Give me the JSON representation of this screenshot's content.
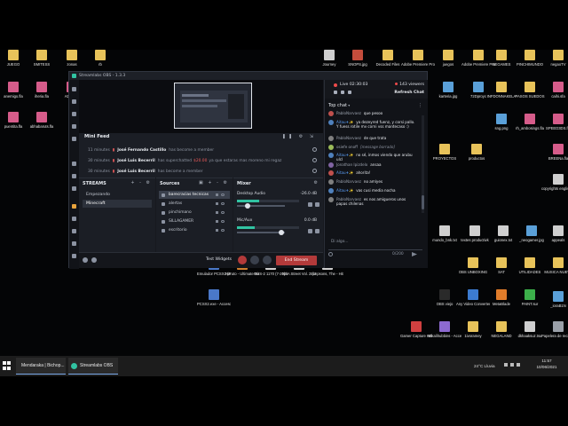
{
  "desktop_icons_top": [
    {
      "label": "JUEGO",
      "color": "#e8c35a"
    },
    {
      "label": "SMITESS",
      "color": "#e8c35a"
    },
    {
      "label": "zonas",
      "color": "#e8c35a"
    },
    {
      "label": "rb",
      "color": "#e8c35a"
    },
    {
      "label": "Journey",
      "color": "#cfcfcf"
    },
    {
      "label": "SNOPS.jpg",
      "color": "#c44d3c"
    },
    {
      "label": "Decoded Files",
      "color": "#e8c35a"
    },
    {
      "label": "Adobe Premiere Pro Preview Files",
      "color": "#e8c35a"
    },
    {
      "label": "juegos",
      "color": "#e8c35a"
    },
    {
      "label": "Adobe Premiere Pro Auto-Saves",
      "color": "#e8c35a"
    },
    {
      "label": "NEGAMES",
      "color": "#e8c35a"
    },
    {
      "label": "PINCHIMUNDO",
      "color": "#e8c35a"
    },
    {
      "label": "negaoTV",
      "color": "#e8c35a"
    }
  ],
  "desktop_icons_row2": [
    {
      "label": "anemigo.fla",
      "color": "#d65c8a"
    },
    {
      "label": "iheria.fla",
      "color": "#d65c8a"
    },
    {
      "label": "ADSo.fla",
      "color": "#d65c8a"
    },
    {
      "label": "xx.fla",
      "color": "#d65c8a"
    },
    {
      "label": "karteria.jpg",
      "color": "#5aa0d8"
    },
    {
      "label": "72Dproyc",
      "color": "#5aa0d8"
    },
    {
      "label": "INFDONNAKELA",
      "color": "#e8c35a"
    },
    {
      "label": "PASOS SUEDOS",
      "color": "#e8c35a"
    },
    {
      "label": "caihi.sfa",
      "color": "#d65c8a"
    }
  ],
  "desktop_icons_row3": [
    {
      "label": "puentita.fla",
      "color": "#d65c8a"
    },
    {
      "label": "abhabaruts.fla",
      "color": "#d65c8a"
    },
    {
      "label": "sng.png",
      "color": "#5aa0d8"
    },
    {
      "label": "rh_ambosings.fla",
      "color": "#d65c8a"
    },
    {
      "label": "SPEED3DS.fla",
      "color": "#d65c8a"
    }
  ],
  "desktop_icons_row4": [
    {
      "label": "PROYECTOS",
      "color": "#e8c35a"
    },
    {
      "label": "productos",
      "color": "#e8c35a"
    },
    {
      "label": "BREENa.fla",
      "color": "#d65c8a"
    }
  ],
  "desktop_icons_right": [
    {
      "label": "copyrights english depon",
      "color": "#cfcfcf"
    },
    {
      "label": "appeals",
      "color": "#cfcfcf"
    },
    {
      "label": "MUSICA NUEVA",
      "color": "#e8c35a"
    },
    {
      "label": "_ioraB1N",
      "color": "#5aa0d8"
    },
    {
      "label": "Papelera de reciclaje",
      "color": "#9aa0a8"
    }
  ],
  "desktop_icons_row5": [
    {
      "label": "mundo_bnk.txt",
      "color": "#cfcfcf"
    },
    {
      "label": "textes productivk",
      "color": "#cfcfcf"
    },
    {
      "label": "guionex.txt",
      "color": "#cfcfcf"
    },
    {
      "label": "_neogamer.jpg",
      "color": "#5aa0d8"
    }
  ],
  "desktop_icons_row6": [
    {
      "label": "OBS UNBOXING",
      "color": "#e8c35a"
    },
    {
      "label": "SAT",
      "color": "#e8c35a"
    },
    {
      "label": "UTILIDADES",
      "color": "#e8c35a"
    }
  ],
  "desktop_icons_row7": [
    {
      "label": "OBS viejo",
      "color": "#2a2a2a"
    },
    {
      "label": "Any Video Converter",
      "color": "#3c7bd0"
    },
    {
      "label": "MetaBlade",
      "color": "#e07c2a"
    },
    {
      "label": "PAINT.sur",
      "color": "#3cb04a"
    }
  ],
  "desktop_icons_row8": [
    {
      "label": "Gamer Capture HD",
      "color": "#d04040"
    },
    {
      "label": "Mikalihubbins - Acceso directo",
      "color": "#8d6ad0"
    },
    {
      "label": "1ivoramey",
      "color": "#e8c35a"
    },
    {
      "label": "NEGALAND",
      "color": "#e8c35a"
    },
    {
      "label": "dkhaaksuz.tsu",
      "color": "#cfcfcf"
    }
  ],
  "desktop_icons_midbottom": [
    {
      "label": "Emulador PCSX2 (Portable)",
      "color": "#4a78c8"
    },
    {
      "label": "Naruto - Ultimate Ninja...",
      "color": "#d08030"
    },
    {
      "label": "GUS-2 1170 (7-20).iso",
      "color": "#cfcfcf"
    },
    {
      "label": "NBA Street Vol. 2 (USA).iso",
      "color": "#cfcfcf"
    },
    {
      "label": "Simpsons, The - Hit & Run.iso",
      "color": "#cfcfcf"
    },
    {
      "label": "PCSX2.exe - Acceso directo",
      "color": "#4a78c8"
    }
  ],
  "obs": {
    "title": "Streamlabs OBS - 1.3.3",
    "mini_feed": {
      "heading": "Mini Feed",
      "rows": [
        {
          "time": "11 minutes",
          "name": "José Fernando Castillo",
          "text": "has become a member"
        },
        {
          "time": "30 minutes",
          "name": "José Luis Becerril",
          "text": "has superchatted",
          "amount": "$20.00",
          "text2": "ya que estaras mas moreno mi regaz"
        },
        {
          "time": "30 minutes",
          "name": "José Luis Becerril",
          "text": "has become a member"
        }
      ]
    },
    "streams": {
      "title": "STREAMS",
      "tools": "+ - ⚙",
      "items": [
        "Empezando",
        "Minecraft"
      ],
      "selected": 1
    },
    "sources": {
      "title": "Sources",
      "tools": "▣ + - ⚙",
      "items": [
        "barecracias tecnicas",
        "alertas",
        "pinchimano",
        "SILLAGAMER",
        "escritorio"
      ],
      "selected": 0
    },
    "mixer": {
      "title": "Mixer",
      "tools": "⚙",
      "channels": [
        {
          "name": "Desktop Audio",
          "db": "-26.0 dB",
          "level": 0.35,
          "volume": 0.22
        },
        {
          "name": "Mic/Aux",
          "db": "0.0 dB",
          "level": 0.28,
          "volume": 0.92
        }
      ]
    },
    "bottom": {
      "test_widgets": "Test Widgets",
      "end_stream": "End Stream"
    },
    "chat": {
      "live_time": "Live 02:30:03",
      "viewers": "143 viewers",
      "refresh": "Refresh Chat",
      "top_chat": "Top chat",
      "menu": "⋮",
      "messages": [
        {
          "author": "PabloNarvaez",
          "text": "que pesoo",
          "avatar": "#c0504d",
          "blue": false
        },
        {
          "author": "Aitau✈✨",
          "text": "ya dezeyred fuenz, y corsi pallo. Y fuess rotile mv corni vss mantecaso :)",
          "avatar": "#4f81bd",
          "blue": true
        },
        {
          "author": "PabloNarvaez",
          "text": "de que trata",
          "avatar": "#7f7f7f",
          "blue": false
        },
        {
          "author": "osiefe onoff",
          "text": "[message borrado]",
          "avatar": "#9bbb59",
          "blue": false,
          "deleted": true
        },
        {
          "author": "Aitau✈✨",
          "text": "no sé, inmos viendo que arubu ulcl",
          "avatar": "#4f81bd",
          "blue": true
        },
        {
          "author": "Jonathan Ipizdelo",
          "text": "ansaa",
          "avatar": "#8064a2",
          "blue": false
        },
        {
          "author": "Aitau✈✨",
          "text": "ahorita!",
          "avatar": "#c0504d",
          "blue": true
        },
        {
          "author": "PabloNarvaez",
          "text": "no amlyes",
          "avatar": "#7f7f7f",
          "blue": false
        },
        {
          "author": "Aitau✈✨",
          "text": "vas cusi media nocha",
          "avatar": "#4f81bd",
          "blue": true
        },
        {
          "author": "PabloNarvaez",
          "text": "es nos amigueros unos papas chilenas",
          "avatar": "#7f7f7f",
          "blue": false
        }
      ],
      "input_placeholder": "Di algo...",
      "count": "0/200"
    }
  },
  "taskbar": {
    "apps": [
      {
        "label": "Mendaraka | Bichop...",
        "color": "#e84c3d"
      },
      {
        "label": "Streamlabs OBS",
        "color": "#31c3a2"
      }
    ],
    "weather": "24°C Lluvia",
    "time": "11:57",
    "date": "10/06/2021"
  }
}
